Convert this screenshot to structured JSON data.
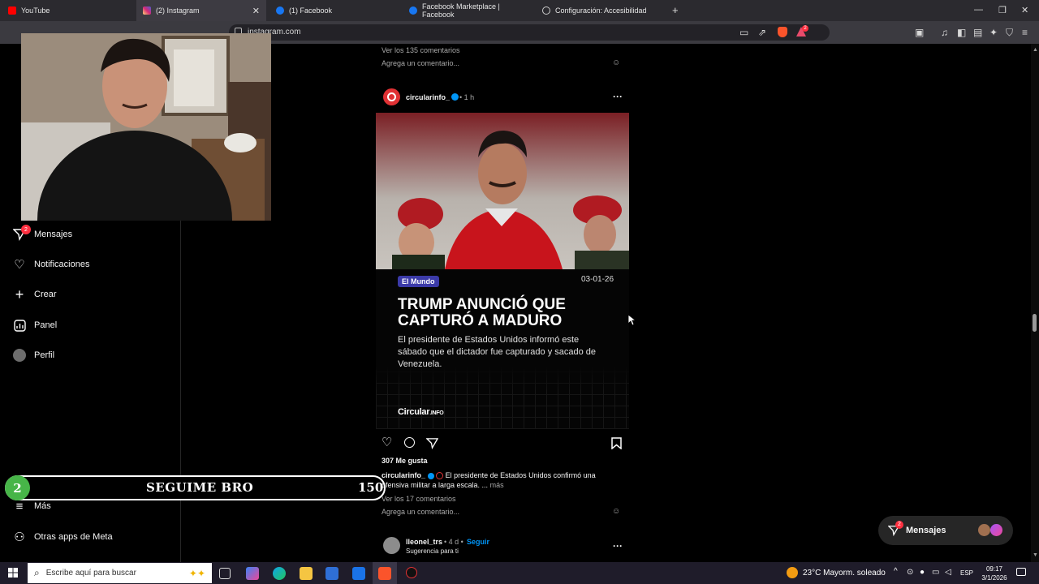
{
  "browser": {
    "tabs": [
      {
        "label": "YouTube",
        "color": "#ff0000"
      },
      {
        "label": "(2) Instagram",
        "color": "#d62976",
        "active": true
      },
      {
        "label": "(1) Facebook",
        "color": "#1877f2"
      },
      {
        "label": "Facebook Marketplace | Facebook",
        "color": "#1877f2"
      },
      {
        "label": "Configuración: Accesibilidad",
        "color": "#cccccc"
      }
    ],
    "new_tab": "+",
    "url": "instagram.com",
    "shield_badge": "2"
  },
  "sidebar": {
    "items": [
      {
        "label": "Mensajes",
        "icon": "messages-icon",
        "badge": "2"
      },
      {
        "label": "Notificaciones",
        "icon": "heart-icon"
      },
      {
        "label": "Crear",
        "icon": "plus-icon"
      },
      {
        "label": "Panel",
        "icon": "dashboard-icon"
      },
      {
        "label": "Perfil",
        "icon": "avatar-icon"
      }
    ],
    "more": "Más",
    "meta_apps": "Otras apps de Meta"
  },
  "overlay": {
    "number": "2",
    "text": "SEGUIME BRO",
    "count": "150"
  },
  "feed": {
    "prev_comments": "Ver los 135 comentarios",
    "prev_add_comment": "Agrega un comentario...",
    "post": {
      "username": "circularinfo_",
      "time": "• 1 h",
      "tag": "El Mundo",
      "date": "03-01-26",
      "headline": "TRUMP ANUNCIÓ QUE CAPTURÓ A MADURO",
      "subtext": "El presidente de Estados Unidos informó este sábado que el dictador fue capturado y sacado de Venezuela.",
      "brand_main": "Circular",
      "brand_suffix": ".INFO",
      "likes": "307 Me gusta",
      "caption_user": "circularinfo_",
      "caption_text": "El presidente de Estados Unidos confirmó una ofensiva militar a larga escala. ...",
      "caption_more": "más",
      "view_comments": "Ver los 17 comentarios",
      "add_comment": "Agrega un comentario..."
    },
    "next_post": {
      "username": "lleonel_trs",
      "time": "• 4 d •",
      "follow": "Seguir",
      "suggestion": "Sugerencia para ti"
    }
  },
  "messages_pill": {
    "label": "Mensajes",
    "badge": "2"
  },
  "taskbar": {
    "search_placeholder": "Escribe aquí para buscar",
    "weather": "23°C  Mayorm. soleado",
    "lang": "ESP",
    "time": "09:17",
    "date": "3/1/2026"
  },
  "colors": {
    "accent": "#0095f6",
    "badge": "#ff3040",
    "overlay_green": "#47b548"
  }
}
